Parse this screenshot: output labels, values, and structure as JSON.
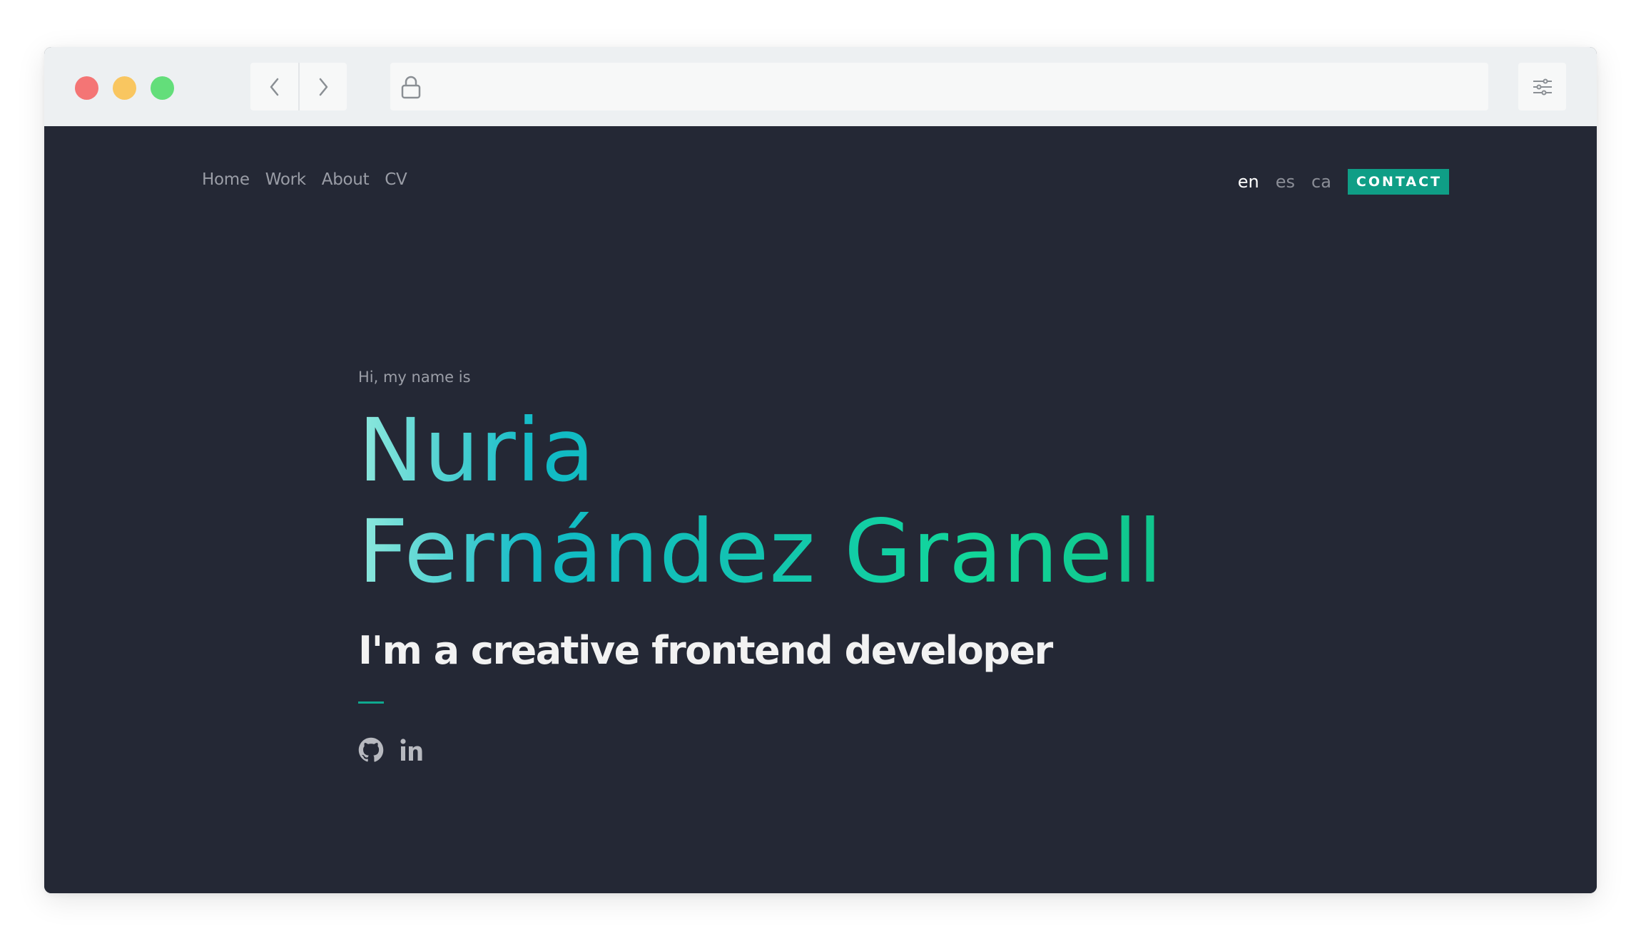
{
  "browser": {
    "controls": [
      "close",
      "minimize",
      "maximize"
    ],
    "back_icon": "chevron-left-icon",
    "forward_icon": "chevron-right-icon",
    "url_icon": "lock-icon",
    "url": "",
    "menu_icon": "sliders-icon"
  },
  "site": {
    "nav": [
      {
        "label": "Home"
      },
      {
        "label": "Work"
      },
      {
        "label": "About"
      },
      {
        "label": "CV"
      }
    ],
    "languages": [
      {
        "label": "en",
        "active": true
      },
      {
        "label": "es",
        "active": false
      },
      {
        "label": "ca",
        "active": false
      }
    ],
    "contact_label": "CONTACT"
  },
  "hero": {
    "greeting": "Hi, my name is",
    "name_line1": "Nuria",
    "name_line2": "Fernández Granell",
    "tagline": "I'm a creative frontend developer",
    "social": [
      {
        "icon": "github-icon"
      },
      {
        "icon": "linkedin-icon"
      }
    ]
  },
  "colors": {
    "background": "#242835",
    "accent": "#0f9e86",
    "gradient_start": "#8ee8dd",
    "gradient_end": "#10c48c"
  }
}
